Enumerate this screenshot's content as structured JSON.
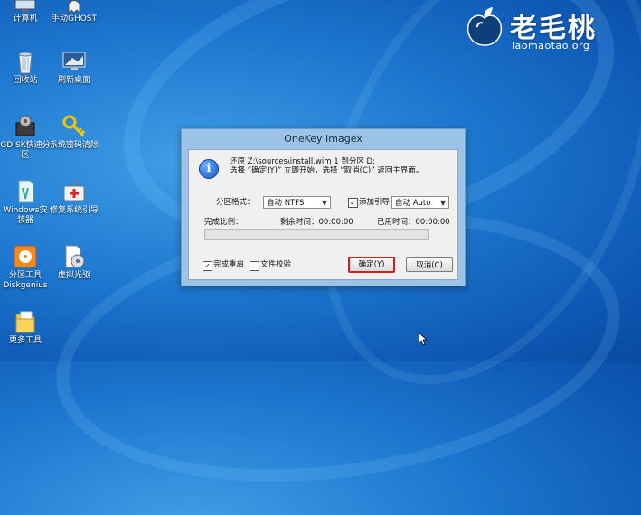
{
  "desktop": {
    "icons": [
      {
        "label": "计算机",
        "icon": "computer-icon"
      },
      {
        "label": "手动GHOST",
        "icon": "ghost-icon"
      },
      {
        "label": "回收站",
        "icon": "recycle-bin-icon"
      },
      {
        "label": "刷新桌面",
        "icon": "monitor-icon"
      },
      {
        "label": "GDISK快速分区",
        "icon": "gdisk-icon"
      },
      {
        "label": "系统密码清除",
        "icon": "key-icon"
      },
      {
        "label": "Windows安装器",
        "icon": "windows-installer-icon"
      },
      {
        "label": "修复系统引导",
        "icon": "repair-kit-icon"
      },
      {
        "label": "分区工具Diskgenius",
        "icon": "diskgenius-icon"
      },
      {
        "label": "虚拟光驱",
        "icon": "virtual-drive-icon"
      },
      {
        "label": "更多工具",
        "icon": "folder-icon"
      }
    ]
  },
  "logo": {
    "brand": "老毛桃",
    "url": "laomaotao.org",
    "icon": "peach-logo-icon"
  },
  "dialog": {
    "title": "OneKey Imagex",
    "message_line1": "还原 Z:\\sources\\install.wim 1 到分区 D:",
    "message_line2": "选择 “确定(Y)” 立即开始，选择 “取消(C)” 返回主界面。",
    "partition_format_label": "分区格式：",
    "partition_format_value": "自动 NTFS",
    "add_boot_label": "添加引导",
    "add_boot_checked": true,
    "boot_value": "自动 Auto",
    "progress_label": "完成比例：",
    "remaining_label": "剩余时间：00:00:00",
    "elapsed_label": "已用时间：00:00:00",
    "progress_fraction": 0.0,
    "restart_label": "完成重启",
    "restart_checked": true,
    "verify_label": "文件校验",
    "verify_checked": false,
    "ok_label": "确定(Y)",
    "cancel_label": "取消(C)"
  },
  "colors": {
    "accent_highlight": "#d01e1e",
    "progress_fill": "#3ea04a",
    "desktop_blue": "#1d77cf"
  }
}
